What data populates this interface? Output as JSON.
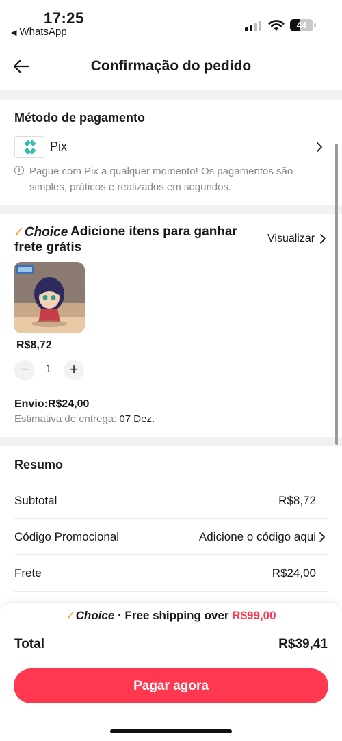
{
  "status_bar": {
    "time": "17:25",
    "back_app": "WhatsApp",
    "battery": "44",
    "battery_level": 0.44
  },
  "header": {
    "title": "Confirmação do pedido",
    "back_icon": "arrow-left-icon"
  },
  "payment": {
    "title": "Método de pagamento",
    "method": "Pix",
    "info": "Pague com Pix a qualquer momento! Os pagamentos são simples, práticos e realizados em segundos."
  },
  "choice": {
    "brand": "Choice",
    "title": "Adicione itens para ganhar frete grátis",
    "view_label": "Visualizar",
    "item_price": "R$8,72",
    "quantity": "1",
    "shipping": "Envio:R$24,00",
    "estimate_label": "Estimativa de entrega:",
    "estimate_value": "07 Dez."
  },
  "summary": {
    "title": "Resumo",
    "rows": [
      {
        "label": "Subtotal",
        "value": "R$8,72"
      },
      {
        "label": "Código Promocional",
        "value": "Adicione o código aqui"
      },
      {
        "label": "Frete",
        "value": "R$24,00"
      }
    ]
  },
  "bottom": {
    "promo_brand": "Choice",
    "promo_text": "· Free shipping over",
    "promo_amount": "R$99,00",
    "total_label": "Total",
    "total_value": "R$39,41",
    "pay_label": "Pagar agora"
  },
  "colors": {
    "accent": "#fd384f",
    "choice_check": "#f5a623",
    "pix": "#32bcad"
  }
}
